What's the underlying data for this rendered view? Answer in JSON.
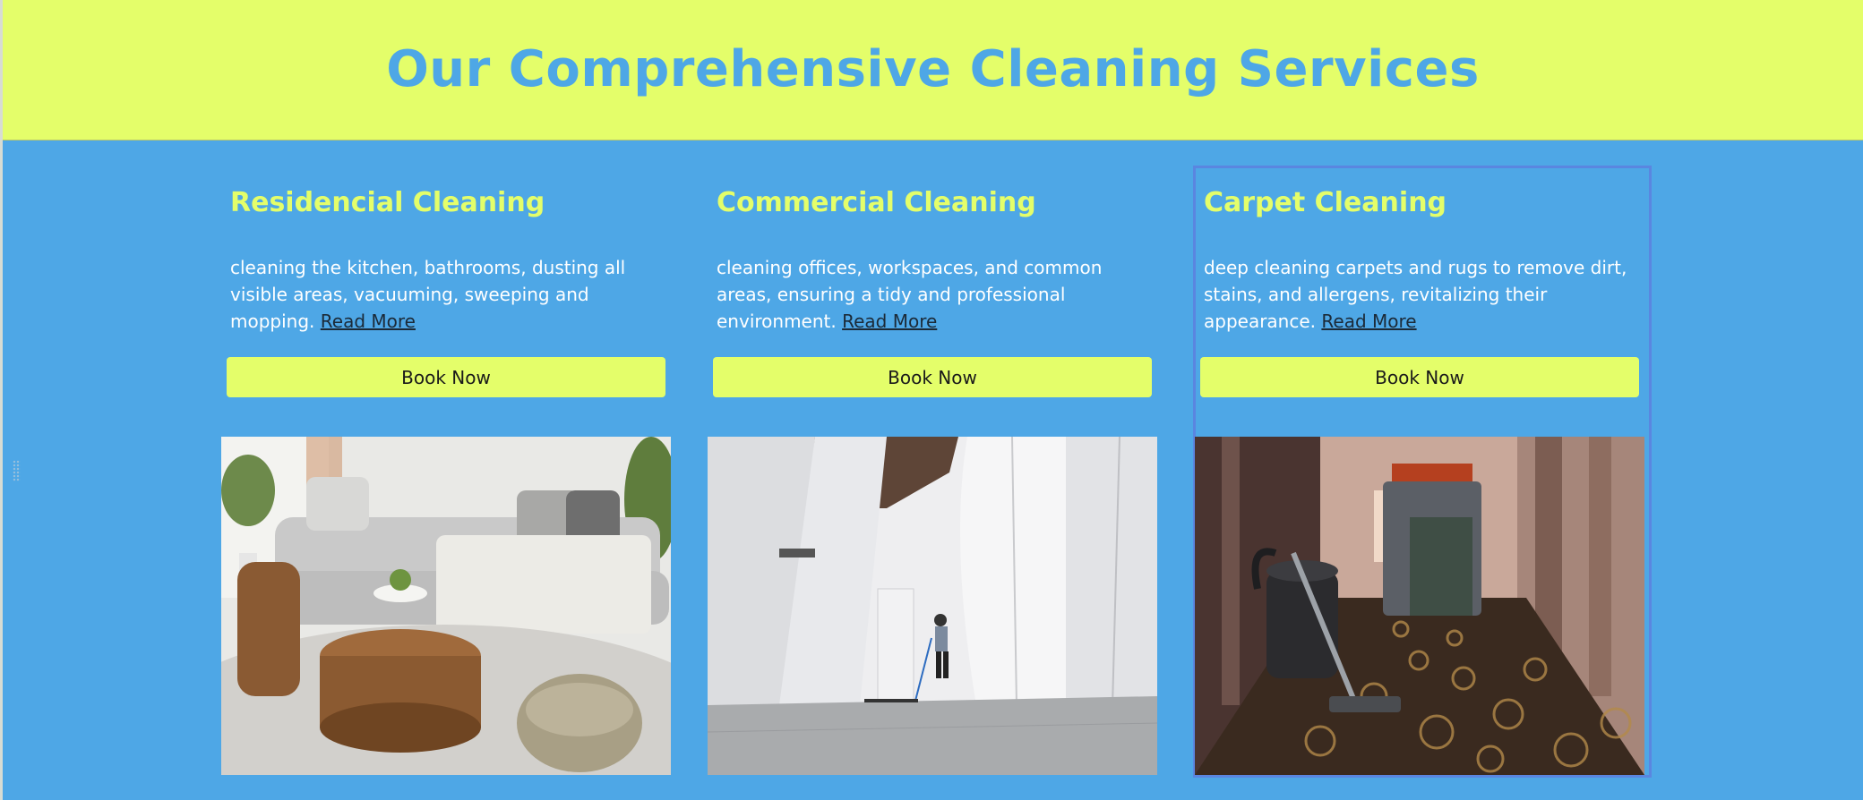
{
  "header": {
    "title": "Our Comprehensive Cleaning Services"
  },
  "services": [
    {
      "title": "Residencial Cleaning",
      "description": "cleaning the kitchen, bathrooms, dusting all visible areas, vacuuming, sweeping and mopping. ",
      "read_more": "Read More",
      "button": "Book Now",
      "image": "living-room-photo"
    },
    {
      "title": "Commercial Cleaning",
      "description": "cleaning offices, workspaces, and common areas, ensuring a tidy and professional environment. ",
      "read_more": "Read More",
      "button": "Book Now",
      "image": "office-hallway-cleaner-photo"
    },
    {
      "title": "Carpet Cleaning",
      "description": "deep cleaning carpets and rugs to remove dirt, stains, and allergens, revitalizing their appearance.  ",
      "read_more": "Read More",
      "button": "Book Now",
      "image": "hotel-corridor-vacuum-photo"
    }
  ],
  "colors": {
    "background": "#4ea7e6",
    "accent": "#e4fe6a",
    "title_text": "#4ea7e6"
  }
}
